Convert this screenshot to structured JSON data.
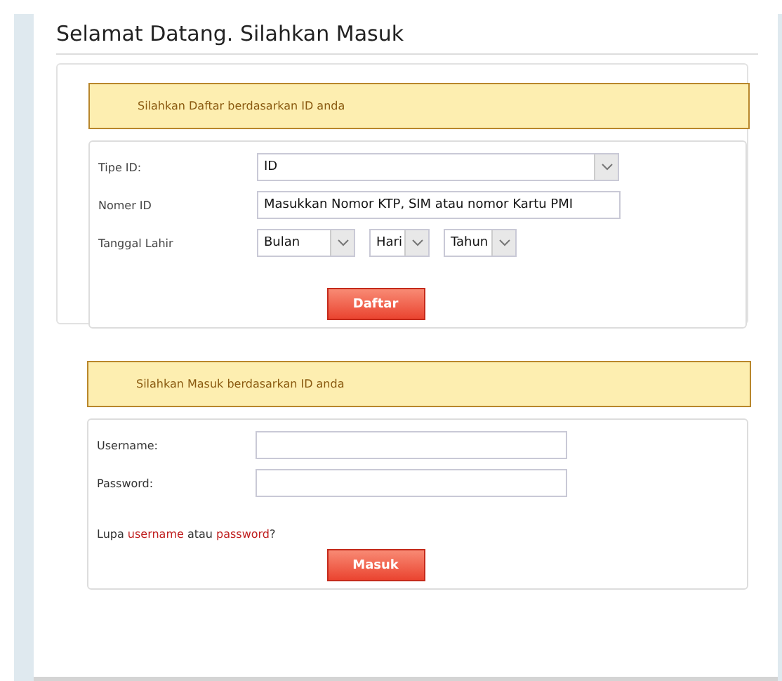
{
  "title": "Selamat Datang. Silahkan Masuk",
  "register": {
    "notice": "Silahkan Daftar berdasarkan ID anda",
    "id_type": {
      "label": "Tipe ID:",
      "value": "ID"
    },
    "id_number": {
      "label": "Nomer ID",
      "value": "Masukkan Nomor KTP, SIM atau nomor Kartu PMI"
    },
    "birth_date": {
      "label": "Tanggal Lahir",
      "selects": [
        {
          "value": "Bulan",
          "kind": "month"
        },
        {
          "value": "Hari",
          "kind": "day"
        },
        {
          "value": "Tahun",
          "kind": "year"
        }
      ]
    },
    "button": "Daftar"
  },
  "login": {
    "notice": "Silahkan Masuk berdasarkan ID anda",
    "username": {
      "label": "Username:"
    },
    "password": {
      "label": "Password:"
    },
    "forgot": {
      "prefix": "Lupa",
      "link_1": "username",
      "middle": "atau",
      "link_2": "password",
      "suffix": "?"
    },
    "button": "Masuk"
  }
}
